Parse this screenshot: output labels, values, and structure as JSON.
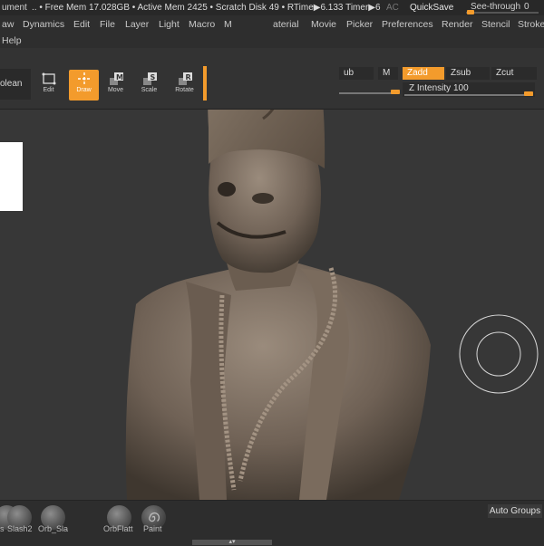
{
  "topbar": {
    "doc": "ument",
    "free_mem": ".. • Free Mem 17.028GB • Active Mem 2425 • Scratch Disk 49 • RTime▶6.133 Timer▶6",
    "ac": "AC",
    "quicksave": "QuickSave",
    "seethrough_label": "See-through",
    "seethrough_value": "0"
  },
  "menu": {
    "row1": [
      "aw",
      "Dynamics",
      "Edit",
      "File",
      "Layer",
      "Light",
      "Macro",
      "M",
      "aterial",
      "Movie",
      "Picker",
      "Preferences",
      "Render",
      "Stencil",
      "Stroke"
    ],
    "row2": [
      "Help"
    ]
  },
  "toolbar": {
    "boolean": "olean",
    "tools": [
      {
        "label": "Edit",
        "icon": "edit-icon"
      },
      {
        "label": "Draw",
        "icon": "draw-icon"
      },
      {
        "label": "Move",
        "icon": "move-icon"
      },
      {
        "label": "Scale",
        "icon": "scale-icon"
      },
      {
        "label": "Rotate",
        "icon": "rotate-icon"
      }
    ],
    "sub_partial": "ub",
    "m": "M",
    "zadd": "Zadd",
    "zsub": "Zsub",
    "zcut": "Zcut",
    "z_intensity_label": "Z Intensity",
    "z_intensity_value": "100"
  },
  "bottom": {
    "brushes": [
      "s",
      "Slash2",
      "Orb_Sla",
      "OrbFlatt",
      "Paint"
    ],
    "auto_groups": "Auto Groups"
  },
  "colors": {
    "accent": "#f39b2c",
    "bg": "#373737"
  }
}
